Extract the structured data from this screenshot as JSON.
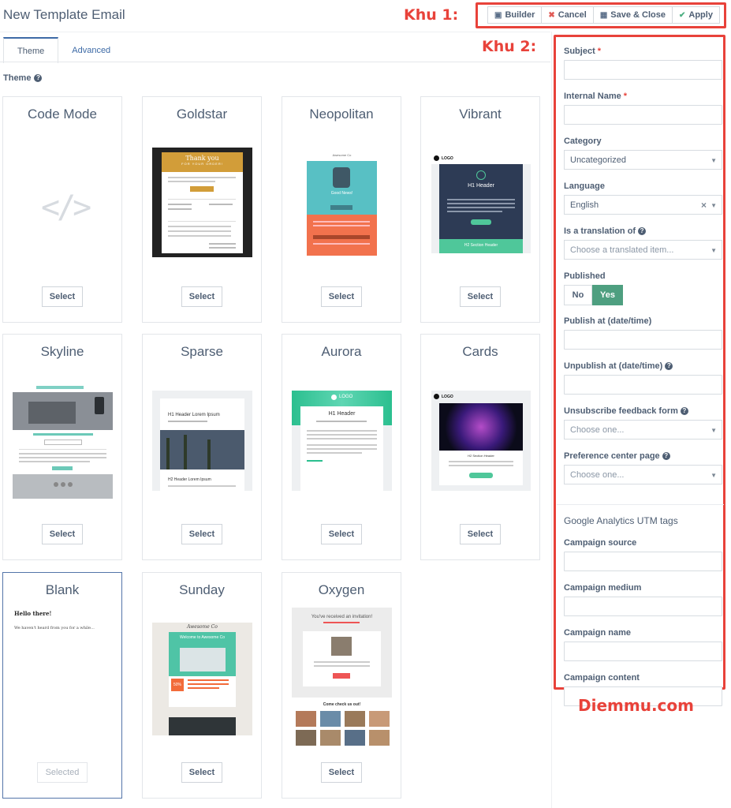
{
  "header": {
    "title": "New Template Email",
    "annotations": {
      "zone1": "Khu 1:",
      "zone2": "Khu 2:"
    },
    "toolbar": {
      "builder": "Builder",
      "cancel": "Cancel",
      "save_close": "Save & Close",
      "apply": "Apply"
    }
  },
  "tabs": [
    {
      "label": "Theme",
      "active": true
    },
    {
      "label": "Advanced",
      "active": false
    }
  ],
  "theme_section": {
    "label": "Theme"
  },
  "themes": [
    {
      "name": "Code Mode",
      "button": "Select"
    },
    {
      "name": "Goldstar",
      "button": "Select"
    },
    {
      "name": "Neopolitan",
      "button": "Select"
    },
    {
      "name": "Vibrant",
      "button": "Select"
    },
    {
      "name": "Skyline",
      "button": "Select"
    },
    {
      "name": "Sparse",
      "button": "Select"
    },
    {
      "name": "Aurora",
      "button": "Select"
    },
    {
      "name": "Cards",
      "button": "Select"
    },
    {
      "name": "Blank",
      "button": "Selected"
    },
    {
      "name": "Sunday",
      "button": "Select"
    },
    {
      "name": "Oxygen",
      "button": "Select"
    }
  ],
  "thumbs": {
    "goldstar": {
      "banner": "Thank you",
      "sub": "FOR YOUR ORDER!"
    },
    "neopolitan": {
      "brand": "Awesome Co",
      "hero": "Good News!"
    },
    "vibrant": {
      "logo": "LOGO",
      "h1": "H1 Header",
      "h2": "H2 Section Header"
    },
    "sparse": {
      "h1": "H1 Header Lorem Ipsum",
      "h2": "H2 Header Lorem Ipsum"
    },
    "aurora": {
      "logo": "LOGO",
      "h1": "H1 Header"
    },
    "cards": {
      "logo": "LOGO",
      "h2": "H2 Section Header"
    },
    "blank": {
      "greeting": "Hello there!",
      "body": "We haven't heard from you for a while..."
    },
    "sunday": {
      "brand": "Awesome Co",
      "welcome": "Welcome to Awesome Co",
      "pct": "50%"
    },
    "oxygen": {
      "invite": "You've received an invitation!",
      "check": "Come check us out!"
    }
  },
  "sidebar": {
    "subject": {
      "label": "Subject",
      "value": ""
    },
    "internal_name": {
      "label": "Internal Name",
      "value": ""
    },
    "category": {
      "label": "Category",
      "value": "Uncategorized"
    },
    "language": {
      "label": "Language",
      "value": "English"
    },
    "translation": {
      "label": "Is a translation of",
      "placeholder": "Choose a translated item..."
    },
    "published": {
      "label": "Published",
      "no": "No",
      "yes": "Yes",
      "value": true
    },
    "publish_at": {
      "label": "Publish at (date/time)",
      "value": ""
    },
    "unpublish_at": {
      "label": "Unpublish at (date/time)",
      "value": ""
    },
    "unsubscribe_form": {
      "label": "Unsubscribe feedback form",
      "placeholder": "Choose one..."
    },
    "preference_page": {
      "label": "Preference center page",
      "placeholder": "Choose one..."
    },
    "ga_title": "Google Analytics UTM tags",
    "campaign_source": {
      "label": "Campaign source",
      "value": ""
    },
    "campaign_medium": {
      "label": "Campaign medium",
      "value": ""
    },
    "campaign_name": {
      "label": "Campaign name",
      "value": ""
    },
    "campaign_content": {
      "label": "Campaign content",
      "value": ""
    }
  },
  "brand": "Diemmu.com"
}
